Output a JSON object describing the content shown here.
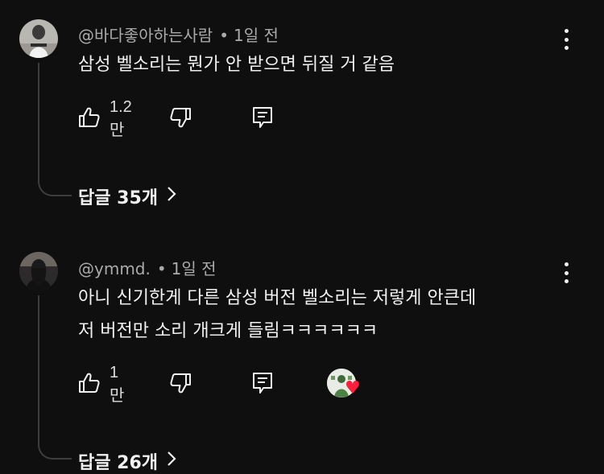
{
  "comments": [
    {
      "author": "@바다좋아하는사람",
      "separator": "•",
      "time": "1일 전",
      "text": "삼성 벨소리는 뭔가 안 받으면 뒤질 거 같음",
      "likes": "1.2만",
      "replies_label": "답글 35개"
    },
    {
      "author": "@ymmd.",
      "separator": "•",
      "time": "1일 전",
      "text_lines": [
        "아니 신기한게 다른 삼성 버전 벨소리는 저렇게 안큰데",
        "저 버전만 소리 개크게 들림ㅋㅋㅋㅋㅋㅋ"
      ],
      "likes": "1만",
      "replies_label": "답글 26개",
      "creator_heart": true
    }
  ],
  "colors": {
    "background": "#0f0f0f",
    "text": "#f1f1f1",
    "meta": "#aaaaaa",
    "heart": "#ff1e3c"
  },
  "icons": [
    "thumbs-up-icon",
    "thumbs-down-icon",
    "reply-icon",
    "more-vert-icon",
    "chevron-right-icon",
    "heart-icon"
  ]
}
